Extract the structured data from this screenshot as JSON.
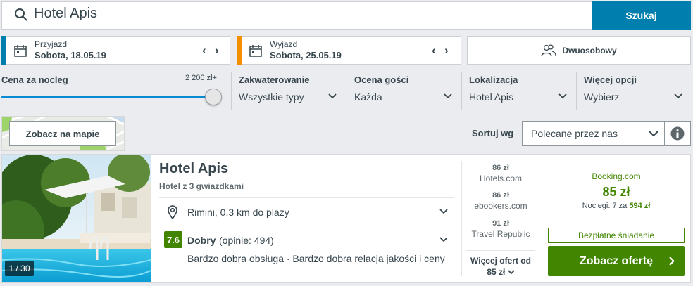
{
  "search": {
    "query": "Hotel Apis",
    "button_label": "Szukaj"
  },
  "dates": {
    "checkin": {
      "label": "Przyjazd",
      "value": "Sobota, 18.05.19",
      "color": "#007faf"
    },
    "checkout": {
      "label": "Wyjazd",
      "value": "Sobota, 25.05.19",
      "color": "#f48f00"
    },
    "prev_glyph": "‹",
    "next_glyph": "›"
  },
  "guests": {
    "label": "Dwuosobowy",
    "icon": "users-icon"
  },
  "filters": {
    "price": {
      "label": "Cena za nocleg",
      "max": "2 200 zł+"
    },
    "accommodation": {
      "label": "Zakwaterowanie",
      "value": "Wszystkie typy"
    },
    "rating": {
      "label": "Ocena gości",
      "value": "Każda"
    },
    "location": {
      "label": "Lokalizacja",
      "value": "Hotel Apis"
    },
    "more": {
      "label": "Więcej opcji",
      "value": "Wybierz"
    }
  },
  "toolbar": {
    "map_button": "Zobacz na mapie",
    "sort_label": "Sortuj wg",
    "sort_value": "Polecane przez nas"
  },
  "result": {
    "name": "Hotel Apis",
    "stars_text": "Hotel z 3 gwiazdkami",
    "photo_counter": "1 / 30",
    "location": "Rimini, 0.3 km do plaży",
    "rating_score": "7.6",
    "rating_word": "Dobry",
    "rating_count": "(opinie: 494)",
    "rating_tags": "Bardzo dobra obsługa · Bardzo dobra relacja jakości i ceny",
    "offers": [
      {
        "price": "86 zł",
        "site": "Hotels.com"
      },
      {
        "price": "86 zł",
        "site": "ebookers.com"
      },
      {
        "price": "91 zł",
        "site": "Travel Republic"
      }
    ],
    "more_offers_label": "Więcej ofert od",
    "more_offers_price": "85 zł",
    "best": {
      "provider": "Booking.com",
      "price": "85 zł",
      "nights_prefix": "Noclegi: 7 za",
      "nights_total": "594 zł",
      "perk": "Bezpłatne śniadanie",
      "button": "Zobacz ofertę"
    },
    "accent_green": "#428500"
  }
}
